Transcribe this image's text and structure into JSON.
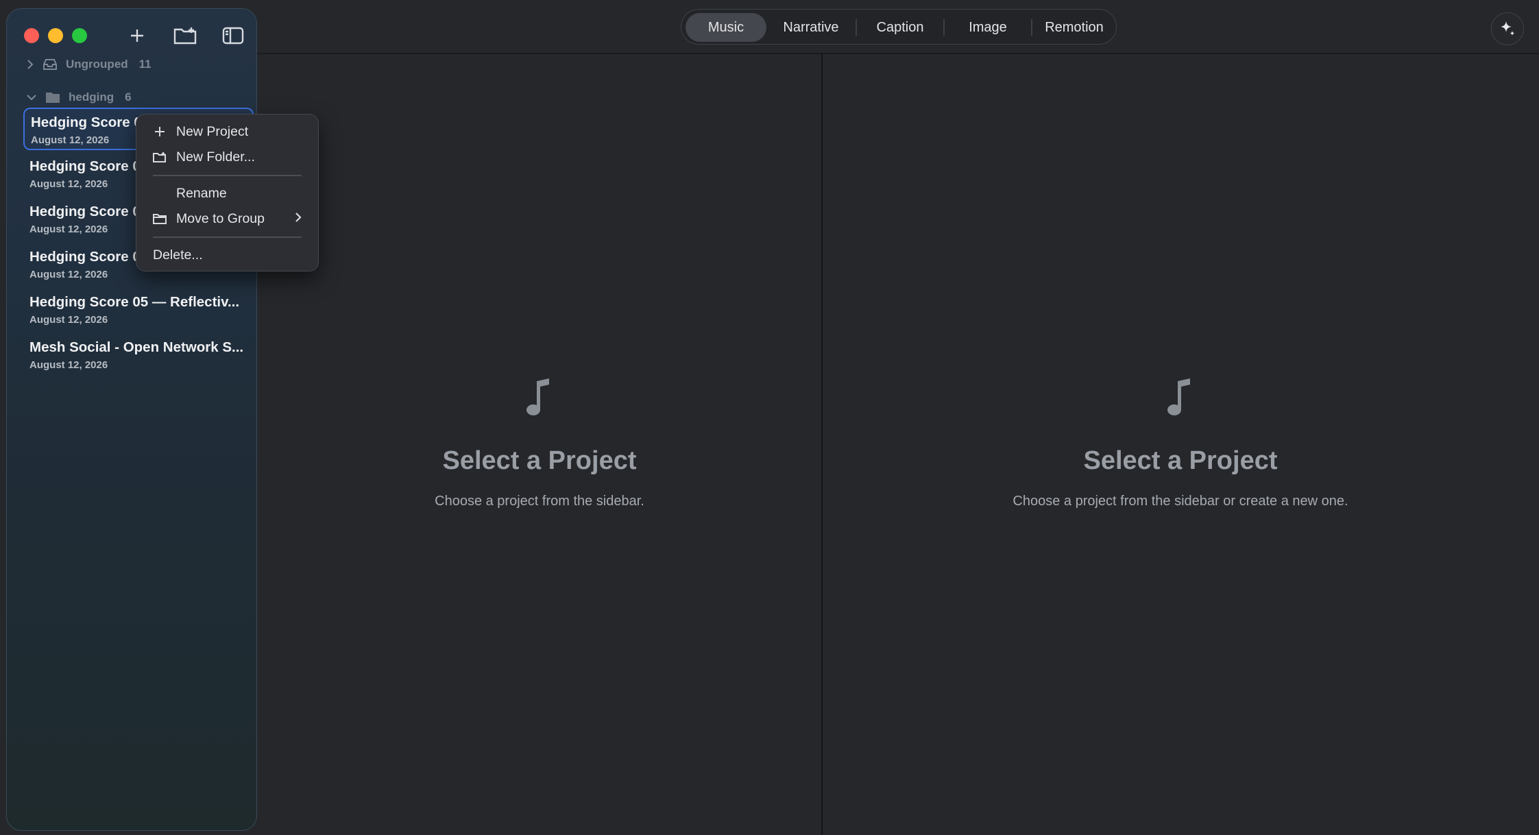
{
  "sidebar": {
    "toolbar": {
      "new_icon": "plus-icon",
      "folder_icon": "folder-plus-icon",
      "sidebar_icon": "sidebar-toggle-icon"
    },
    "groups": [
      {
        "label": "Ungrouped",
        "count": "11",
        "expanded": false
      },
      {
        "label": "hedging",
        "count": "6",
        "expanded": true
      }
    ],
    "projects": [
      {
        "name": "Hedging Score 01",
        "date": "August 12, 2026",
        "selected": true
      },
      {
        "name": "Hedging Score 0",
        "date": "August 12, 2026"
      },
      {
        "name": "Hedging Score 0",
        "date": "August 12, 2026"
      },
      {
        "name": "Hedging Score 0",
        "date": "August 12, 2026"
      },
      {
        "name": "Hedging Score 05 — Reflectiv...",
        "date": "August 12, 2026"
      },
      {
        "name": "Mesh Social - Open Network S...",
        "date": "August 12, 2026"
      }
    ]
  },
  "context_menu": {
    "items": [
      {
        "label": "New Project",
        "icon": "plus-icon"
      },
      {
        "label": "New Folder...",
        "icon": "folder-plus-icon"
      },
      {
        "label": "Rename",
        "icon": ""
      },
      {
        "label": "Move to Group",
        "icon": "folder-icon",
        "submenu": true
      },
      {
        "label": "Delete...",
        "icon": ""
      }
    ]
  },
  "tabs": [
    {
      "label": "Music",
      "active": true
    },
    {
      "label": "Narrative"
    },
    {
      "label": "Caption"
    },
    {
      "label": "Image"
    },
    {
      "label": "Remotion"
    }
  ],
  "left_panel": {
    "icon": "music-note-icon",
    "title": "Select a Project",
    "subtitle": "Choose a project from the sidebar."
  },
  "right_panel": {
    "icon": "music-note-icon",
    "title": "Select a Project",
    "subtitle": "Choose a project from the sidebar or create a new one."
  },
  "colors": {
    "accent": "#3d6fe0",
    "close": "#ff5f57",
    "minimize": "#febc2e",
    "maximize": "#28c840"
  }
}
